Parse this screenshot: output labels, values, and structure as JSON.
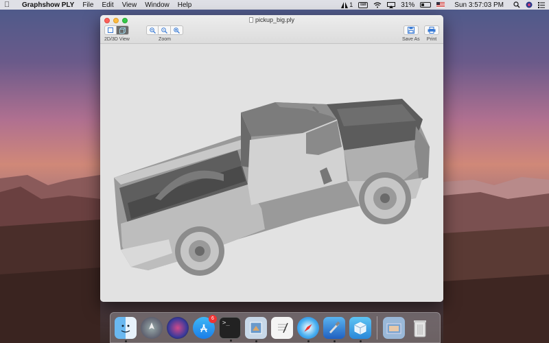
{
  "menubar": {
    "app_name": "Graphshow PLY",
    "menus": [
      "File",
      "Edit",
      "View",
      "Window",
      "Help"
    ],
    "adobe_count": "1",
    "battery": "31%",
    "clock": "Sun 3:57:03 PM",
    "icons": [
      "apple-icon",
      "adobe-icon",
      "keyboard-icon",
      "wifi-icon",
      "airplay-icon",
      "battery-icon",
      "flag-icon",
      "search-icon",
      "siri-icon",
      "list-icon"
    ]
  },
  "window": {
    "title": "pickup_big.ply",
    "toolbar": {
      "view_label": "2D/3D View",
      "zoom_label": "Zoom",
      "save_label": "Save As",
      "print_label": "Print"
    }
  },
  "dock": {
    "items": [
      {
        "name": "finder-icon",
        "running": true
      },
      {
        "name": "launchpad-icon",
        "running": false
      },
      {
        "name": "siri-icon",
        "running": false
      },
      {
        "name": "app-store-icon",
        "running": false,
        "badge": "6"
      },
      {
        "name": "terminal-icon",
        "running": true
      },
      {
        "name": "preview-icon",
        "running": true
      },
      {
        "name": "textedit-icon",
        "running": false
      },
      {
        "name": "safari-icon",
        "running": true
      },
      {
        "name": "xcode-icon",
        "running": true
      },
      {
        "name": "graphshow-ply-icon",
        "running": true
      },
      {
        "name": "downloads-folder-icon",
        "running": false
      },
      {
        "name": "trash-icon",
        "running": false
      }
    ]
  }
}
